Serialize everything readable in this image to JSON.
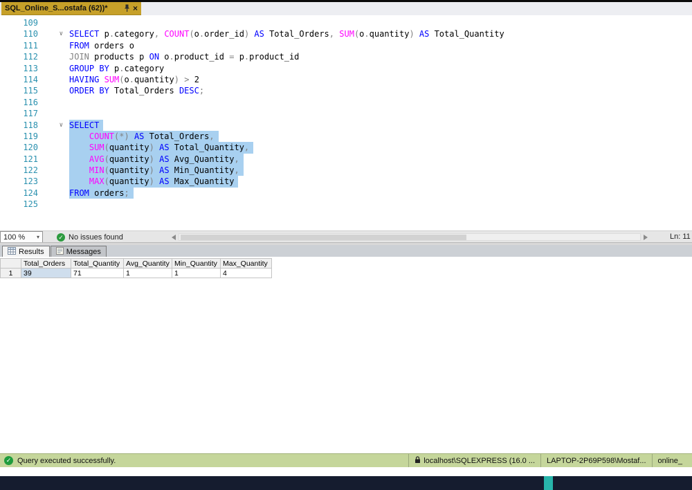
{
  "window": {
    "tab_title": "SQL_Online_S...ostafa (62))*"
  },
  "editor": {
    "zoom": "100 %",
    "health": "No issues found",
    "line_indicator": "Ln: 11",
    "lines": [
      {
        "n": 109,
        "seg": []
      },
      {
        "n": 110,
        "fold": true,
        "seg": [
          [
            "kw",
            "SELECT"
          ],
          [
            "pl",
            " p"
          ],
          [
            "op",
            "."
          ],
          [
            "pl",
            "category"
          ],
          [
            "op",
            ","
          ],
          [
            "pl",
            " "
          ],
          [
            "fn",
            "COUNT"
          ],
          [
            "op",
            "("
          ],
          [
            "pl",
            "o"
          ],
          [
            "op",
            "."
          ],
          [
            "pl",
            "order_id"
          ],
          [
            "op",
            ")"
          ],
          [
            "pl",
            " "
          ],
          [
            "kw",
            "AS"
          ],
          [
            "pl",
            " Total_Orders"
          ],
          [
            "op",
            ","
          ],
          [
            "pl",
            " "
          ],
          [
            "fn",
            "SUM"
          ],
          [
            "op",
            "("
          ],
          [
            "pl",
            "o"
          ],
          [
            "op",
            "."
          ],
          [
            "pl",
            "quantity"
          ],
          [
            "op",
            ")"
          ],
          [
            "pl",
            " "
          ],
          [
            "kw",
            "AS"
          ],
          [
            "pl",
            " Total_Quantity"
          ]
        ]
      },
      {
        "n": 111,
        "seg": [
          [
            "kw",
            "FROM"
          ],
          [
            "pl",
            " orders o"
          ]
        ]
      },
      {
        "n": 112,
        "seg": [
          [
            "op",
            "JOIN"
          ],
          [
            "pl",
            " products p "
          ],
          [
            "kw",
            "ON"
          ],
          [
            "pl",
            " o"
          ],
          [
            "op",
            "."
          ],
          [
            "pl",
            "product_id "
          ],
          [
            "op",
            "="
          ],
          [
            "pl",
            " p"
          ],
          [
            "op",
            "."
          ],
          [
            "pl",
            "product_id"
          ]
        ]
      },
      {
        "n": 113,
        "seg": [
          [
            "kw",
            "GROUP BY"
          ],
          [
            "pl",
            " p"
          ],
          [
            "op",
            "."
          ],
          [
            "pl",
            "category"
          ]
        ]
      },
      {
        "n": 114,
        "seg": [
          [
            "kw",
            "HAVING"
          ],
          [
            "pl",
            " "
          ],
          [
            "fn",
            "SUM"
          ],
          [
            "op",
            "("
          ],
          [
            "pl",
            "o"
          ],
          [
            "op",
            "."
          ],
          [
            "pl",
            "quantity"
          ],
          [
            "op",
            ")"
          ],
          [
            "pl",
            " "
          ],
          [
            "op",
            ">"
          ],
          [
            "pl",
            " 2"
          ]
        ]
      },
      {
        "n": 115,
        "seg": [
          [
            "kw",
            "ORDER BY"
          ],
          [
            "pl",
            " Total_Orders "
          ],
          [
            "kw",
            "DESC"
          ],
          [
            "op",
            ";"
          ]
        ]
      },
      {
        "n": 116,
        "seg": []
      },
      {
        "n": 117,
        "seg": []
      },
      {
        "n": 118,
        "fold": true,
        "sel": true,
        "seg": [
          [
            "kw",
            "SELECT"
          ]
        ]
      },
      {
        "n": 119,
        "sel": true,
        "seg": [
          [
            "pl",
            "    "
          ],
          [
            "fn",
            "COUNT"
          ],
          [
            "op",
            "(*)"
          ],
          [
            "pl",
            " "
          ],
          [
            "kw",
            "AS"
          ],
          [
            "pl",
            " Total_Orders"
          ],
          [
            "op",
            ","
          ]
        ]
      },
      {
        "n": 120,
        "sel": true,
        "seg": [
          [
            "pl",
            "    "
          ],
          [
            "fn",
            "SUM"
          ],
          [
            "op",
            "("
          ],
          [
            "pl",
            "quantity"
          ],
          [
            "op",
            ")"
          ],
          [
            "pl",
            " "
          ],
          [
            "kw",
            "AS"
          ],
          [
            "pl",
            " Total_Quantity"
          ],
          [
            "op",
            ","
          ]
        ]
      },
      {
        "n": 121,
        "sel": true,
        "seg": [
          [
            "pl",
            "    "
          ],
          [
            "fn",
            "AVG"
          ],
          [
            "op",
            "("
          ],
          [
            "pl",
            "quantity"
          ],
          [
            "op",
            ")"
          ],
          [
            "pl",
            " "
          ],
          [
            "kw",
            "AS"
          ],
          [
            "pl",
            " Avg_Quantity"
          ],
          [
            "op",
            ","
          ]
        ]
      },
      {
        "n": 122,
        "sel": true,
        "seg": [
          [
            "pl",
            "    "
          ],
          [
            "fn",
            "MIN"
          ],
          [
            "op",
            "("
          ],
          [
            "pl",
            "quantity"
          ],
          [
            "op",
            ")"
          ],
          [
            "pl",
            " "
          ],
          [
            "kw",
            "AS"
          ],
          [
            "pl",
            " Min_Quantity"
          ],
          [
            "op",
            ","
          ]
        ]
      },
      {
        "n": 123,
        "sel": true,
        "seg": [
          [
            "pl",
            "    "
          ],
          [
            "fn",
            "MAX"
          ],
          [
            "op",
            "("
          ],
          [
            "pl",
            "quantity"
          ],
          [
            "op",
            ")"
          ],
          [
            "pl",
            " "
          ],
          [
            "kw",
            "AS"
          ],
          [
            "pl",
            " Max_Quantity"
          ]
        ]
      },
      {
        "n": 124,
        "sel": true,
        "seg": [
          [
            "kw",
            "FROM"
          ],
          [
            "pl",
            " orders"
          ],
          [
            "op",
            ";"
          ]
        ]
      },
      {
        "n": 125,
        "seg": []
      }
    ]
  },
  "results": {
    "tabs": [
      "Results",
      "Messages"
    ],
    "columns": [
      "Total_Orders",
      "Total_Quantity",
      "Avg_Quantity",
      "Min_Quantity",
      "Max_Quantity"
    ],
    "rows": [
      {
        "num": "1",
        "values": [
          "39",
          "71",
          "1",
          "1",
          "4"
        ]
      }
    ],
    "selected_cell": [
      0,
      0
    ]
  },
  "status": {
    "message": "Query executed successfully.",
    "server": "localhost\\SQLEXPRESS (16.0 ...",
    "user": "LAPTOP-2P69P598\\Mostaf...",
    "database": "online_"
  },
  "colors": {
    "keyword": "#0000ff",
    "function": "#ff00ff",
    "operator": "#808080",
    "line_number": "#2b91af",
    "selection": "#a8d0f0",
    "tab_background": "#c6a029",
    "status_bar_background": "#c5d69b",
    "success_green": "#1f9c3d",
    "taskbar_accent": "#28b5ab"
  }
}
